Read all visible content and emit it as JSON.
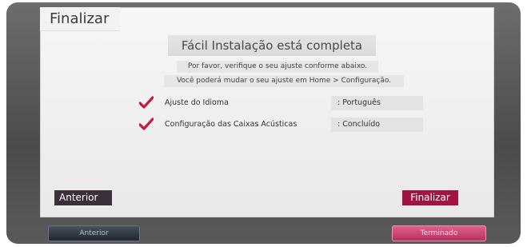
{
  "screen": {
    "title": "Finalizar",
    "heading": "Fácil Instalação está completa",
    "line1": "Por favor, verifique o seu ajuste conforme abaixo.",
    "line2": "Você poderá mudar o seu ajuste em Home > Configuração."
  },
  "settings": [
    {
      "label": "Ajuste do Idioma",
      "value": ": Português",
      "icon": "checkmark-icon"
    },
    {
      "label": "Configuração das Caixas Acústicas",
      "value": ": Concluído",
      "icon": "checkmark-icon"
    }
  ],
  "buttons": {
    "previous": "Anterior",
    "finish": "Finalizar"
  },
  "remote_bar": {
    "previous": "Anterior",
    "done": "Terminado"
  },
  "colors": {
    "accent": "#a0143f",
    "check": "#c8163e",
    "dark_button": "#3a2f3a"
  }
}
